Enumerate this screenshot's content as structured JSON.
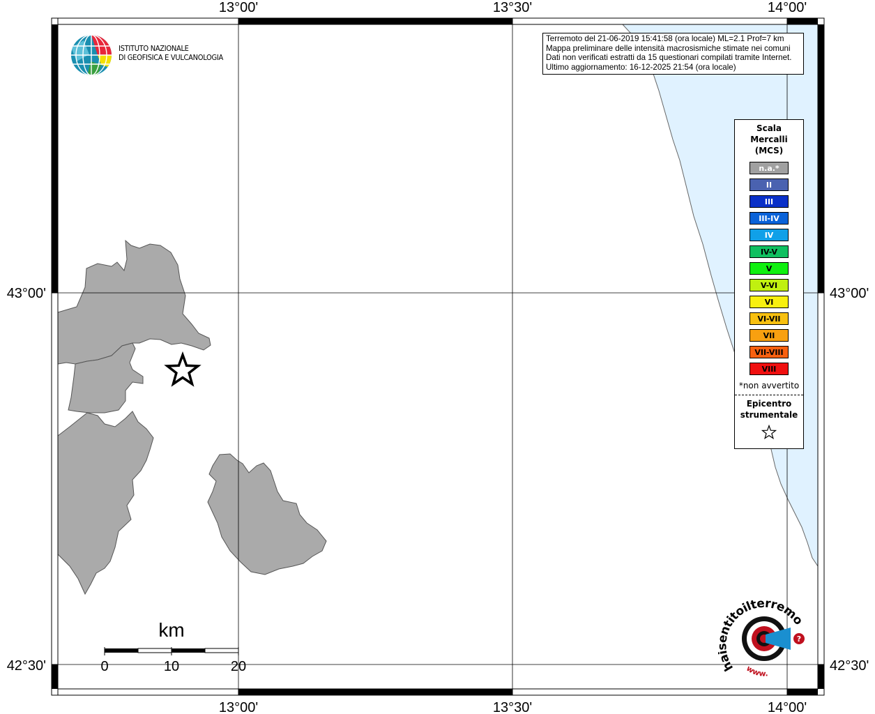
{
  "map": {
    "lon_labels_top": [
      "13°00'",
      "13°30'",
      "14°00'"
    ],
    "lon_labels_bottom": [
      "13°00'",
      "13°30'",
      "14°00'"
    ],
    "lat_labels_left": [
      "43°00'",
      "42°30'"
    ],
    "lat_labels_right": [
      "43°00'",
      "42°30'"
    ],
    "land_color": "#aaaaaa",
    "sea_color": "#e0f2ff"
  },
  "info": {
    "line1": "Terremoto del 21-06-2019 15:41:58 (ora locale) ML=2.1 Prof=7 km",
    "line2": "Mappa preliminare delle intensità macrosismiche stimate nei comuni",
    "line3": "Dati non verificati estratti da 15 questionari compilati tramite Internet.",
    "line4": "Ultimo aggiornamento: 16-12-2025 21:54 (ora locale)"
  },
  "legend": {
    "title_line1": "Scala",
    "title_line2": "Mercalli",
    "title_line3": "(MCS)",
    "items": [
      {
        "label": "n.a.*",
        "color": "#a0a0a0",
        "text_color": "#ffffff"
      },
      {
        "label": "II",
        "color": "#4a62b0",
        "text_color": "#ffffff"
      },
      {
        "label": "III",
        "color": "#0a30c8",
        "text_color": "#ffffff"
      },
      {
        "label": "III-IV",
        "color": "#0a62d8",
        "text_color": "#ffffff"
      },
      {
        "label": "IV",
        "color": "#10a0e8",
        "text_color": "#ffffff"
      },
      {
        "label": "IV-V",
        "color": "#10c060",
        "text_color": "#000000"
      },
      {
        "label": "V",
        "color": "#10f010",
        "text_color": "#000000"
      },
      {
        "label": "V-VI",
        "color": "#c0f010",
        "text_color": "#000000"
      },
      {
        "label": "VI",
        "color": "#f8f010",
        "text_color": "#000000"
      },
      {
        "label": "VI-VII",
        "color": "#f8c010",
        "text_color": "#000000"
      },
      {
        "label": "VII",
        "color": "#f8a010",
        "text_color": "#000000"
      },
      {
        "label": "VII-VIII",
        "color": "#f86010",
        "text_color": "#000000"
      },
      {
        "label": "VIII",
        "color": "#f01010",
        "text_color": "#000000"
      }
    ],
    "note": "*non avvertito",
    "epicentre_line1": "Epicentro",
    "epicentre_line2": "strumentale"
  },
  "logo": {
    "line1": "ISTITUTO NAZIONALE",
    "line2": "DI GEOFISICA E VULCANOLOGIA"
  },
  "scalebar": {
    "unit": "km",
    "ticks": [
      "0",
      "10",
      "20"
    ]
  },
  "hs_logo": {
    "text": "haisentitoilterremoto.it",
    "www": "www."
  }
}
